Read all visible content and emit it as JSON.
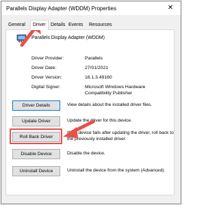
{
  "window": {
    "title": "Parallels Display Adapter (WDDM) Properties",
    "close_glyph": "✕"
  },
  "tabs": [
    {
      "label": "General"
    },
    {
      "label": "Driver"
    },
    {
      "label": "Details"
    },
    {
      "label": "Events"
    },
    {
      "label": "Resources"
    }
  ],
  "device": {
    "name": "Parallels Display Adapter (WDDM)",
    "icon": "display-adapter-icon"
  },
  "properties": [
    {
      "label": "Driver Provider:",
      "value": "Parallels"
    },
    {
      "label": "Driver Date:",
      "value": "27/01/2021"
    },
    {
      "label": "Driver Version:",
      "value": "16.1.3.49160"
    },
    {
      "label": "Digital Signer:",
      "value": "Microsoft Windows Hardware Compatibility Publisher"
    }
  ],
  "actions": [
    {
      "label": "Driver Details",
      "desc": "View details about the installed driver files."
    },
    {
      "label": "Update Driver",
      "desc": "Update the driver for this device."
    },
    {
      "label": "Roll Back Driver",
      "desc": "If the device fails after updating the driver, roll back to the previously installed driver."
    },
    {
      "label": "Disable Device",
      "desc": "Disable the device."
    },
    {
      "label": "Uninstall Device",
      "desc": "Uninstall the device from the system (Advanced)."
    }
  ],
  "colors": {
    "annotation": "#e8504a",
    "focus": "#0078d7"
  }
}
